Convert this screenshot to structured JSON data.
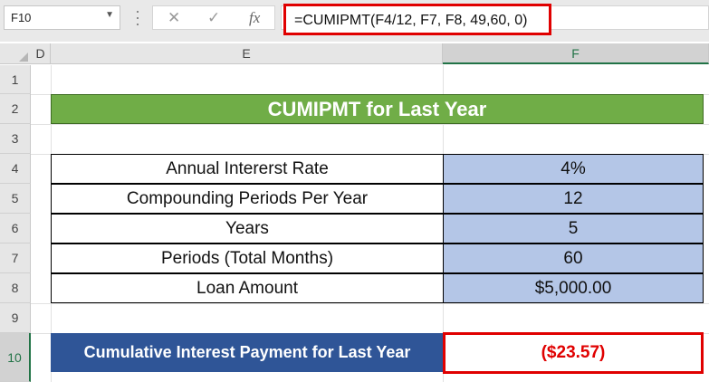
{
  "namebox": {
    "value": "F10"
  },
  "formula_bar": {
    "cancel_icon": "✕",
    "enter_icon": "✓",
    "fx_icon": "fx",
    "formula": "=CUMIPMT(F4/12, F7, F8, 49,60, 0)"
  },
  "columns": [
    "D",
    "E",
    "F"
  ],
  "rows": [
    "1",
    "2",
    "3",
    "4",
    "5",
    "6",
    "7",
    "8",
    "9",
    "10"
  ],
  "title": "CUMIPMT  for Last Year",
  "table": [
    {
      "label": "Annual Intererst Rate",
      "value": "4%"
    },
    {
      "label": "Compounding Periods Per Year",
      "value": "12"
    },
    {
      "label": "Years",
      "value": "5"
    },
    {
      "label": "Periods (Total Months)",
      "value": "60"
    },
    {
      "label": "Loan Amount",
      "value": "$5,000.00"
    }
  ],
  "result": {
    "label": "Cumulative Interest Payment for Last Year",
    "value": "($23.57)"
  },
  "colors": {
    "title_bg": "#70ad47",
    "value_bg": "#b4c6e7",
    "result_label_bg": "#2f5597",
    "highlight": "#e00000"
  }
}
